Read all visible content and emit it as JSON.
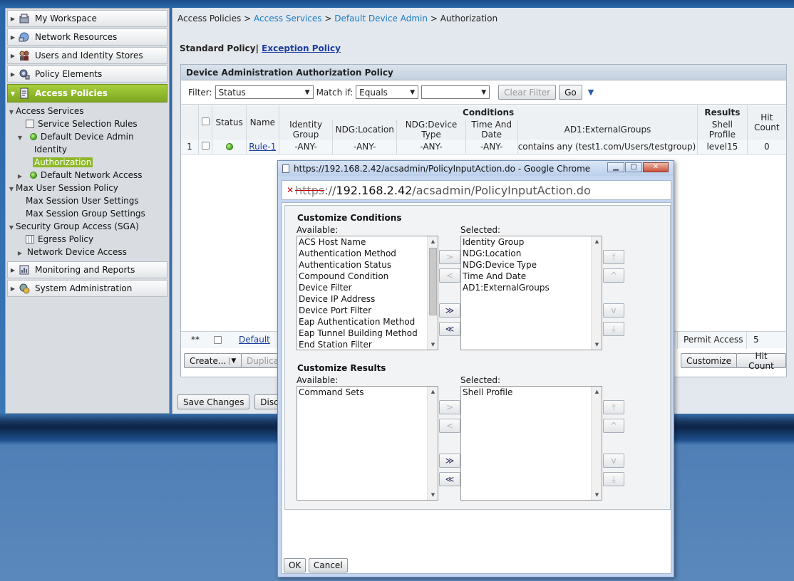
{
  "nav": {
    "drawers_top": [
      {
        "label": "My Workspace",
        "icon": "workspace-icon"
      },
      {
        "label": "Network Resources",
        "icon": "network-icon"
      },
      {
        "label": "Users and Identity Stores",
        "icon": "users-icon"
      },
      {
        "label": "Policy Elements",
        "icon": "policy-elements-icon"
      }
    ],
    "active_drawer": "Access Policies",
    "tree": {
      "access_services": "Access Services",
      "service_selection_rules": "Service Selection Rules",
      "default_device_admin": "Default Device Admin",
      "identity": "Identity",
      "authorization": "Authorization",
      "default_network_access": "Default Network Access",
      "max_user_session_policy": "Max User Session Policy",
      "max_session_user_settings": "Max Session User Settings",
      "max_session_group_settings": "Max Session Group Settings",
      "sga": "Security Group Access (SGA)",
      "egress_policy": "Egress Policy",
      "network_device_access": "Network Device Access"
    },
    "drawers_bottom": [
      {
        "label": "Monitoring and Reports",
        "icon": "monitoring-icon"
      },
      {
        "label": "System Administration",
        "icon": "system-admin-icon"
      }
    ]
  },
  "breadcrumb": {
    "root": "Access Policies",
    "sep": ">",
    "level1": "Access Services",
    "level2": "Default Device Admin",
    "current": "Authorization"
  },
  "policy_tabs": {
    "standard": "Standard Policy|",
    "exception": "Exception Policy"
  },
  "policy": {
    "title": "Device Administration Authorization Policy",
    "filter_label": "Filter:",
    "filter_value": "Status",
    "match_label": "Match if:",
    "match_value": "Equals",
    "value_value": "",
    "clear_filter": "Clear Filter",
    "go": "Go",
    "headers": {
      "status": "Status",
      "name": "Name",
      "conditions": "Conditions",
      "results": "Results",
      "hit_count": "Hit Count",
      "identity_group": "Identity Group",
      "ndg_location": "NDG:Location",
      "ndg_device_type": "NDG:Device Type",
      "time_and_date": "Time And Date",
      "ad1_external_groups": "AD1:ExternalGroups",
      "shell_profile": "Shell Profile"
    },
    "rows": [
      {
        "num": "1",
        "name": "Rule-1",
        "identity_group": "-ANY-",
        "ndg_location": "-ANY-",
        "ndg_device_type": "-ANY-",
        "time_and_date": "-ANY-",
        "ad1_external_groups": "contains any (test1.com/Users/testgroup)",
        "shell_profile": "level15",
        "hit_count": "0",
        "status_color": "#3fa51c"
      }
    ],
    "default_row": {
      "num": "**",
      "name": "Default",
      "result": "Permit Access",
      "hit_count": "5"
    },
    "buttons": {
      "create": "Create...",
      "duplicate": "Duplica",
      "customize": "Customize",
      "hit_count": "Hit Count"
    },
    "save_changes": "Save Changes",
    "discard": "Disca"
  },
  "popup": {
    "title": "https://192.168.2.42/acsadmin/PolicyInputAction.do - Google Chrome",
    "url_scheme": "https",
    "url_host": "192.168.2.42",
    "url_path": "/acsadmin/PolicyInputAction.do",
    "conditions": {
      "title": "Customize Conditions",
      "available_label": "Available:",
      "selected_label": "Selected:",
      "available": [
        "ACS Host Name",
        "Authentication Method",
        "Authentication Status",
        "Compound Condition",
        "Device Filter",
        "Device IP Address",
        "Device Port Filter",
        "Eap Authentication Method",
        "Eap Tunnel Building Method",
        "End Station Filter"
      ],
      "selected": [
        "Identity Group",
        "NDG:Location",
        "NDG:Device Type",
        "Time And Date",
        "AD1:ExternalGroups"
      ]
    },
    "results": {
      "title": "Customize Results",
      "available_label": "Available:",
      "selected_label": "Selected:",
      "available": [
        "Command Sets"
      ],
      "selected": [
        "Shell Profile"
      ]
    },
    "ok": "OK",
    "cancel": "Cancel"
  }
}
